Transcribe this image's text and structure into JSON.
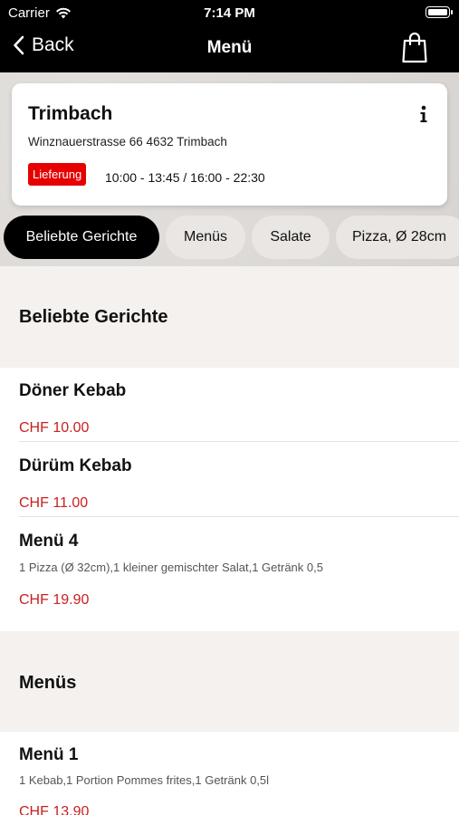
{
  "status_bar": {
    "carrier": "Carrier",
    "time": "7:14 PM"
  },
  "nav": {
    "back_label": "Back",
    "title": "Menü"
  },
  "restaurant": {
    "name": "Trimbach",
    "address": "Winznauerstrasse 66 4632 Trimbach",
    "delivery_badge": "Lieferung",
    "hours": "10:00 - 13:45 / 16:00 - 22:30"
  },
  "tabs": [
    {
      "label": "Beliebte Gerichte",
      "active": true
    },
    {
      "label": "Menüs",
      "active": false
    },
    {
      "label": "Salate",
      "active": false
    },
    {
      "label": "Pizza, Ø 28cm",
      "active": false
    }
  ],
  "sections": [
    {
      "title": "Beliebte Gerichte",
      "items": [
        {
          "name": "Döner Kebab",
          "description": "",
          "price": "CHF 10.00"
        },
        {
          "name": "Dürüm Kebab",
          "description": "",
          "price": "CHF 11.00"
        },
        {
          "name": "Menü 4",
          "description": "1 Pizza (Ø 32cm),1 kleiner gemischter Salat,1 Getränk 0,5",
          "price": "CHF 19.90"
        }
      ]
    },
    {
      "title": "Menüs",
      "items": [
        {
          "name": "Menü 1",
          "description": "1 Kebab,1 Portion Pommes frites,1 Getränk 0,5l",
          "price": "CHF 13.90"
        }
      ]
    }
  ],
  "colors": {
    "accent_red": "#c8201e",
    "badge_red": "#e60000",
    "header_bg": "#000000"
  }
}
